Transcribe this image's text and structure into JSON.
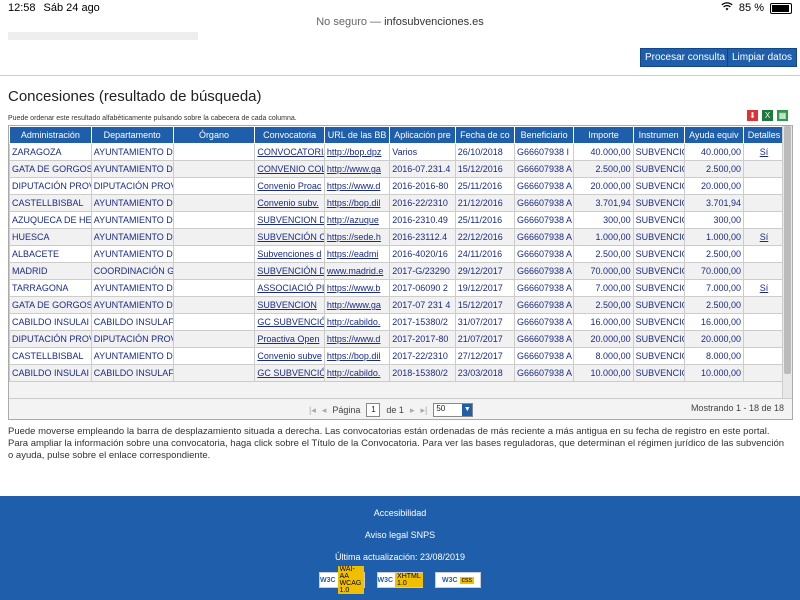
{
  "status": {
    "time": "12:58",
    "date": "Sáb 24 ago",
    "battery": "85 %",
    "battery_level": 0.85
  },
  "address": {
    "security": "No seguro —",
    "host": "infosubvenciones.es"
  },
  "toolbar": {
    "process_label": "Procesar consulta",
    "clear_label": "Limpiar datos"
  },
  "page": {
    "title": "Concesiones (resultado de búsqueda)",
    "hint": "Puede ordenar este resultado alfabéticamente pulsando sobre la cabecera de cada columna."
  },
  "grid": {
    "columns": [
      "Administración",
      "Departamento",
      "Órgano",
      "Convocatoria",
      "URL de las BB",
      "Aplicación pre",
      "Fecha de co",
      "Beneficiario",
      "Importe",
      "Instrumen",
      "Ayuda equiv",
      "Detalles"
    ],
    "rows": [
      [
        "ZARAGOZA",
        "AYUNTAMIENTO D",
        "",
        "CONVOCATORIA",
        "http://bop.dpz",
        "Varios",
        "26/10/2018",
        "G66607938 I",
        "40.000,00",
        "SUBVENCIÓ",
        "40.000,00",
        "Sí"
      ],
      [
        "GATA DE GORGOS",
        "AYUNTAMIENTO D",
        "",
        "CONVENIO COL",
        "http://www.ga",
        "2016-07.231.4",
        "15/12/2016",
        "G66607938 A",
        "2.500,00",
        "SUBVENCIÓ",
        "2.500,00",
        ""
      ],
      [
        "DIPUTACIÓN PROV",
        "DIPUTACIÓN PROV",
        "",
        "Convenio Proac",
        "https://www.d",
        "2016-2016-80",
        "25/11/2016",
        "G66607938 A",
        "20.000,00",
        "SUBVENCIÓ",
        "20.000,00",
        ""
      ],
      [
        "CASTELLBISBAL",
        "AYUNTAMIENTO D",
        "",
        "Convenio subv.",
        "https://bop.dil",
        "2016-22/2310",
        "21/12/2016",
        "G66607938 A",
        "3.701,94",
        "SUBVENCIÓ",
        "3.701,94",
        ""
      ],
      [
        "AZUQUECA DE HE",
        "AYUNTAMIENTO D",
        "",
        "SUBVENCION D",
        "http://azuque",
        "2016-2310.49",
        "25/11/2016",
        "G66607938 A",
        "300,00",
        "SUBVENCIÓ",
        "300,00",
        ""
      ],
      [
        "HUESCA",
        "AYUNTAMIENTO D",
        "",
        "SUBVENCIÓN C",
        "https://sede.h",
        "2016-23112.4",
        "22/12/2016",
        "G66607938 A",
        "1.000,00",
        "SUBVENCIÓ",
        "1.000,00",
        "Sí"
      ],
      [
        "ALBACETE",
        "AYUNTAMIENTO D",
        "",
        "Subvenciones d",
        "https://eadmi",
        "2016-4020/16",
        "24/11/2016",
        "G66607938 A",
        "2.500,00",
        "SUBVENCIÓ",
        "2.500,00",
        ""
      ],
      [
        "MADRID",
        "COORDINACIÓN G",
        "",
        "SUBVENCIÓN D",
        "www.madrid.e",
        "2017-G/23290",
        "29/12/2017",
        "G66607938 A",
        "70.000,00",
        "SUBVENCIÓ",
        "70.000,00",
        ""
      ],
      [
        "TARRAGONA",
        "AYUNTAMIENTO D",
        "",
        "ASSOCIACIÓ PI",
        "https://www.b",
        "2017-06090 2",
        "19/12/2017",
        "G66607938 A",
        "7.000,00",
        "SUBVENCIÓ",
        "7.000,00",
        "Sí"
      ],
      [
        "GATA DE GORGOS",
        "AYUNTAMIENTO D",
        "",
        "SUBVENCION",
        "http://www.ga",
        "2017-07 231 4",
        "15/12/2017",
        "G66607938 A",
        "2.500,00",
        "SUBVENCIÓ",
        "2.500,00",
        ""
      ],
      [
        "CABILDO INSULAI",
        "CABILDO INSULAF",
        "",
        "GC SUBVENCIÓ",
        "http://cabildo.",
        "2017-15380/2",
        "31/07/2017",
        "G66607938 A",
        "16.000,00",
        "SUBVENCIÓ",
        "16.000,00",
        ""
      ],
      [
        "DIPUTACIÓN PROV",
        "DIPUTACIÓN PROV",
        "",
        "Proactiva Open",
        "https://www.d",
        "2017-2017-80",
        "21/07/2017",
        "G66607938 A",
        "20.000,00",
        "SUBVENCIÓ",
        "20.000,00",
        ""
      ],
      [
        "CASTELLBISBAL",
        "AYUNTAMIENTO D",
        "",
        "Convenio subve",
        "https://bop.dil",
        "2017-22/2310",
        "27/12/2017",
        "G66607938 A",
        "8.000,00",
        "SUBVENCIÓ",
        "8.000,00",
        ""
      ],
      [
        "CABILDO INSULAI",
        "CABILDO INSULAF",
        "",
        "GC SUBVENCIÓ",
        "http://cabildo.",
        "2018-15380/2",
        "23/03/2018",
        "G66607938 A",
        "10.000,00",
        "SUBVENCIÓ",
        "10.000,00",
        ""
      ]
    ]
  },
  "pager": {
    "page_label": "Página",
    "page_value": "1",
    "of_label": "de 1",
    "page_size": "50",
    "count": "Mostrando 1 - 18 de 18"
  },
  "info_text": "Puede moverse empleando la barra de desplazamiento situada a derecha. Las convocatorias están ordenadas de más reciente a más antigua en su fecha de registro en este portal. Para ampliar la información sobre una convocatoria, haga click sobre el Título de la Convocatoria. Para ver las bases reguladoras, que determinan el régimen jurídico de las subvención o ayuda, pulse sobre el enlace correspondiente.",
  "footer": {
    "accessibility": "Accesibilidad",
    "legal": "Aviso legal SNPS",
    "updated": "Última actualización: 23/08/2019",
    "badges": [
      {
        "w3c": "W3C",
        "label": "WAI-AA WCAG 1.0"
      },
      {
        "w3c": "W3C",
        "label": "XHTML 1.0"
      },
      {
        "w3c": "W3C",
        "label": "css"
      }
    ]
  }
}
